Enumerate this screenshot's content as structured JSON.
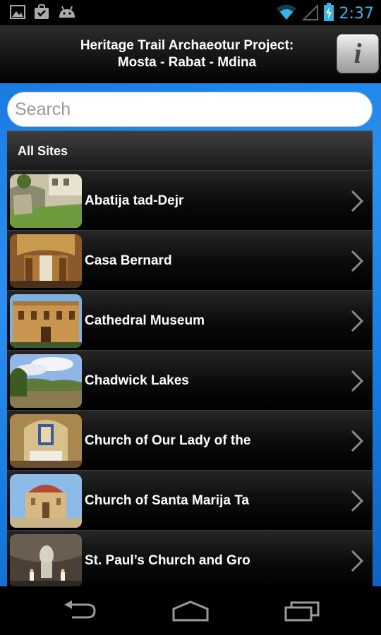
{
  "status_bar": {
    "time": "2:37",
    "left_icons": [
      "image-icon",
      "shopping-bag-icon",
      "android-icon"
    ],
    "right_icons": [
      "wifi-icon",
      "signal-icon",
      "battery-charging-icon"
    ]
  },
  "header": {
    "title_line1": "Heritage Trail Archaeotur Project:",
    "title_line2": "Mosta - Rabat - Mdina",
    "info_label": "i"
  },
  "search": {
    "placeholder": "Search",
    "value": ""
  },
  "list": {
    "header": "All Sites",
    "items": [
      {
        "label": "Abatija tad-Dejr"
      },
      {
        "label": "Casa Bernard"
      },
      {
        "label": "Cathedral Museum"
      },
      {
        "label": "Chadwick Lakes"
      },
      {
        "label": "Church of Our Lady of the"
      },
      {
        "label": "Church of Santa Marija Ta"
      },
      {
        "label": "St. Paul’s Church and Gro"
      }
    ]
  },
  "nav_bar": {
    "buttons": [
      "back-icon",
      "home-icon",
      "recent-apps-icon"
    ]
  },
  "colors": {
    "accent": "#33b5e5",
    "content_background": "#1f86ea",
    "list_background": "#000000"
  }
}
